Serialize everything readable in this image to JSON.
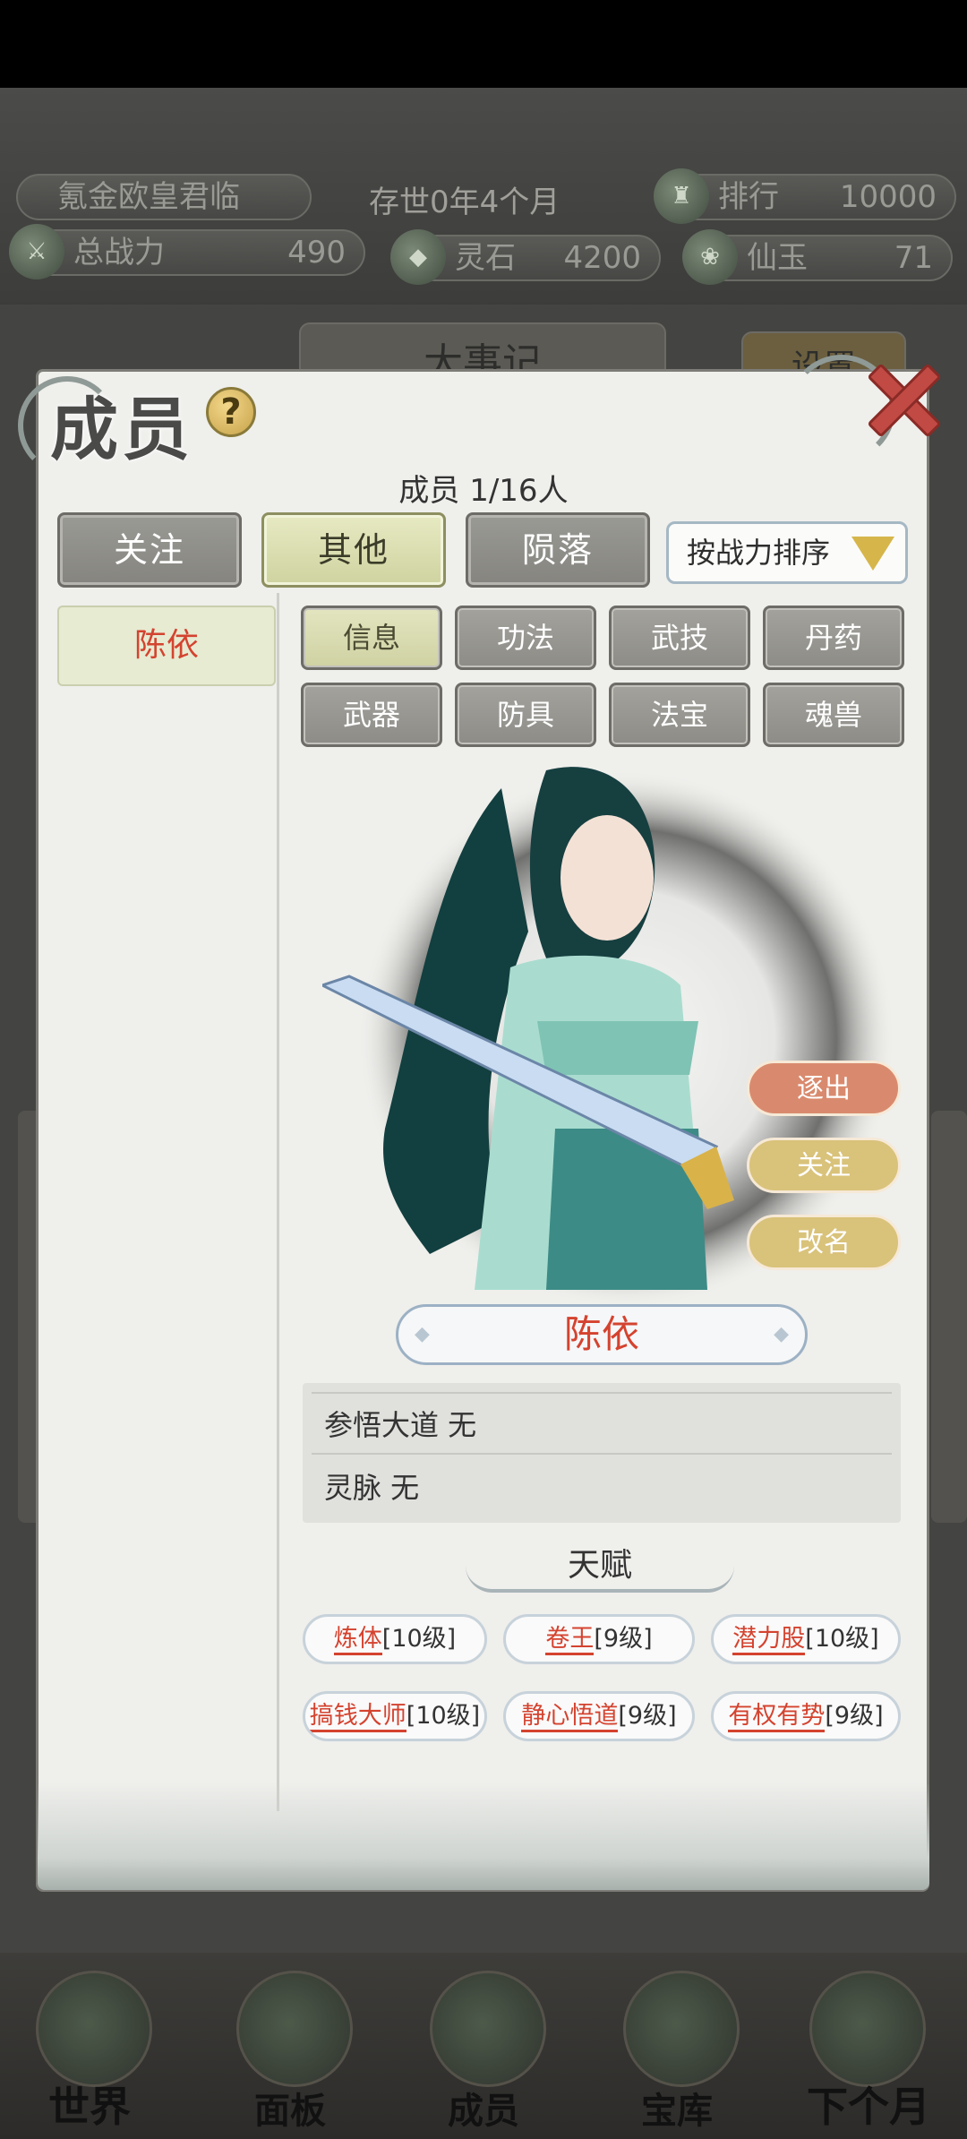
{
  "header": {
    "player_name": "氪金欧皇君临",
    "time_label": "存世0年4个月",
    "rank_label": "排行",
    "rank_value": "10000",
    "power_label": "总战力",
    "power_value": "490",
    "stone_label": "灵石",
    "stone_value": "4200",
    "jade_label": "仙玉",
    "jade_value": "71"
  },
  "background": {
    "record_label": "大事记",
    "settings_label": "设置"
  },
  "panel": {
    "title": "成员",
    "help_symbol": "?",
    "member_count": "成员 1/16人",
    "tabs": [
      {
        "label": "关注",
        "active": false
      },
      {
        "label": "其他",
        "active": true
      },
      {
        "label": "陨落",
        "active": false
      }
    ],
    "sort_label": "按战力排序",
    "members": [
      "陈依"
    ]
  },
  "sub_tabs": [
    {
      "label": "信息",
      "active": true
    },
    {
      "label": "功法",
      "active": false
    },
    {
      "label": "武技",
      "active": false
    },
    {
      "label": "丹药",
      "active": false
    },
    {
      "label": "武器",
      "active": false
    },
    {
      "label": "防具",
      "active": false
    },
    {
      "label": "法宝",
      "active": false
    },
    {
      "label": "魂兽",
      "active": false
    }
  ],
  "character": {
    "name": "陈依",
    "actions": {
      "expel": "逐出",
      "follow": "关注",
      "rename": "改名"
    },
    "info": [
      "参悟大道 无",
      "灵脉 无"
    ]
  },
  "talents": {
    "title": "天赋",
    "items": [
      {
        "name": "炼体",
        "level": "[10级]"
      },
      {
        "name": "卷王",
        "level": "[9级]"
      },
      {
        "name": "潜力股",
        "level": "[10级]"
      },
      {
        "name": "搞钱大师",
        "level": "[10级]"
      },
      {
        "name": "静心悟道",
        "level": "[9级]"
      },
      {
        "name": "有权有势",
        "level": "[9级]"
      }
    ]
  },
  "bottom_nav": [
    "世界",
    "面板",
    "成员",
    "宝库",
    "下个月"
  ],
  "colors": {
    "accent_red": "#d4432f",
    "expel_button": "#d98a6e",
    "follow_button": "#d9c27a",
    "rename_button": "#d9c27a",
    "active_tab": "#cfd3a0"
  }
}
